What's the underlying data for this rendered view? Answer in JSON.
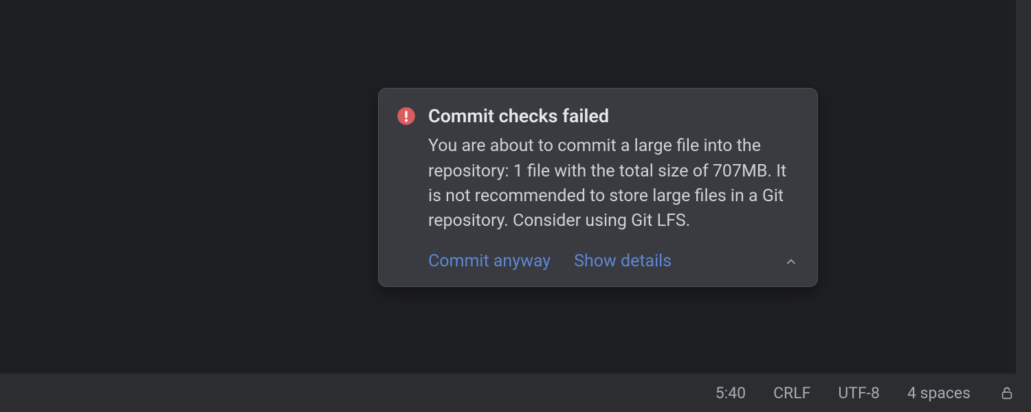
{
  "notification": {
    "title": "Commit checks failed",
    "body": "You are about to commit a large file into the repository: 1 file with the total size of 707MB. It is not recommended to store large files in a Git repository. Consider using Git LFS.",
    "actions": {
      "commit_anyway": "Commit anyway",
      "show_details": "Show details"
    }
  },
  "statusbar": {
    "cursor_position": "5:40",
    "line_separator": "CRLF",
    "encoding": "UTF-8",
    "indent": "4 spaces"
  }
}
